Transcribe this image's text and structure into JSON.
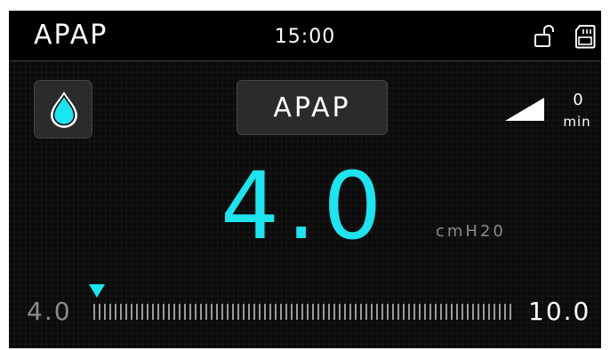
{
  "header": {
    "mode_title": "APAP",
    "time": "15:00",
    "icons": [
      "unlock-icon",
      "sd-card-icon"
    ]
  },
  "controls": {
    "humidifier_icon": "water-drop-icon",
    "mode_button_label": "APAP",
    "ramp_icon": "ramp-icon",
    "ramp_value": "0",
    "ramp_unit": "min"
  },
  "pressure": {
    "value": "4.0",
    "unit": "cmH20"
  },
  "range": {
    "min": "4.0",
    "max": "10.0",
    "current_fraction": 0.0
  },
  "colors": {
    "accent": "#1de4ee",
    "background": "#0b0b0b",
    "panel": "#2b2b2b"
  }
}
